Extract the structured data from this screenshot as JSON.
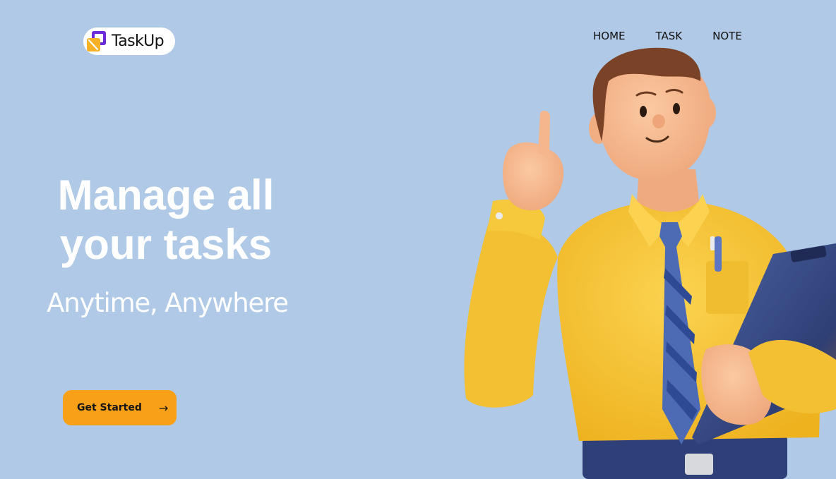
{
  "brand": {
    "name": "TaskUp"
  },
  "nav": {
    "items": [
      "HOME",
      "TASK",
      "NOTE"
    ]
  },
  "hero": {
    "title_line1": "Manage all",
    "title_line2": "your tasks",
    "subtitle": "Anytime, Anywhere",
    "cta_label": "Get Started",
    "cta_arrow": "→"
  },
  "colors": {
    "background": "#afc9e6",
    "cta": "#f8a018",
    "logo_purple": "#6a2bd9",
    "logo_yellow": "#f7b125",
    "shirt": "#f6c83c",
    "tie": "#4d6bb5",
    "clipboard": "#3b4e8c"
  },
  "icons": {
    "logo": "taskup-logo-icon",
    "cta_arrow": "arrow-right-icon"
  },
  "illustration": {
    "subject": "businessman-pointing-up-holding-clipboard"
  }
}
